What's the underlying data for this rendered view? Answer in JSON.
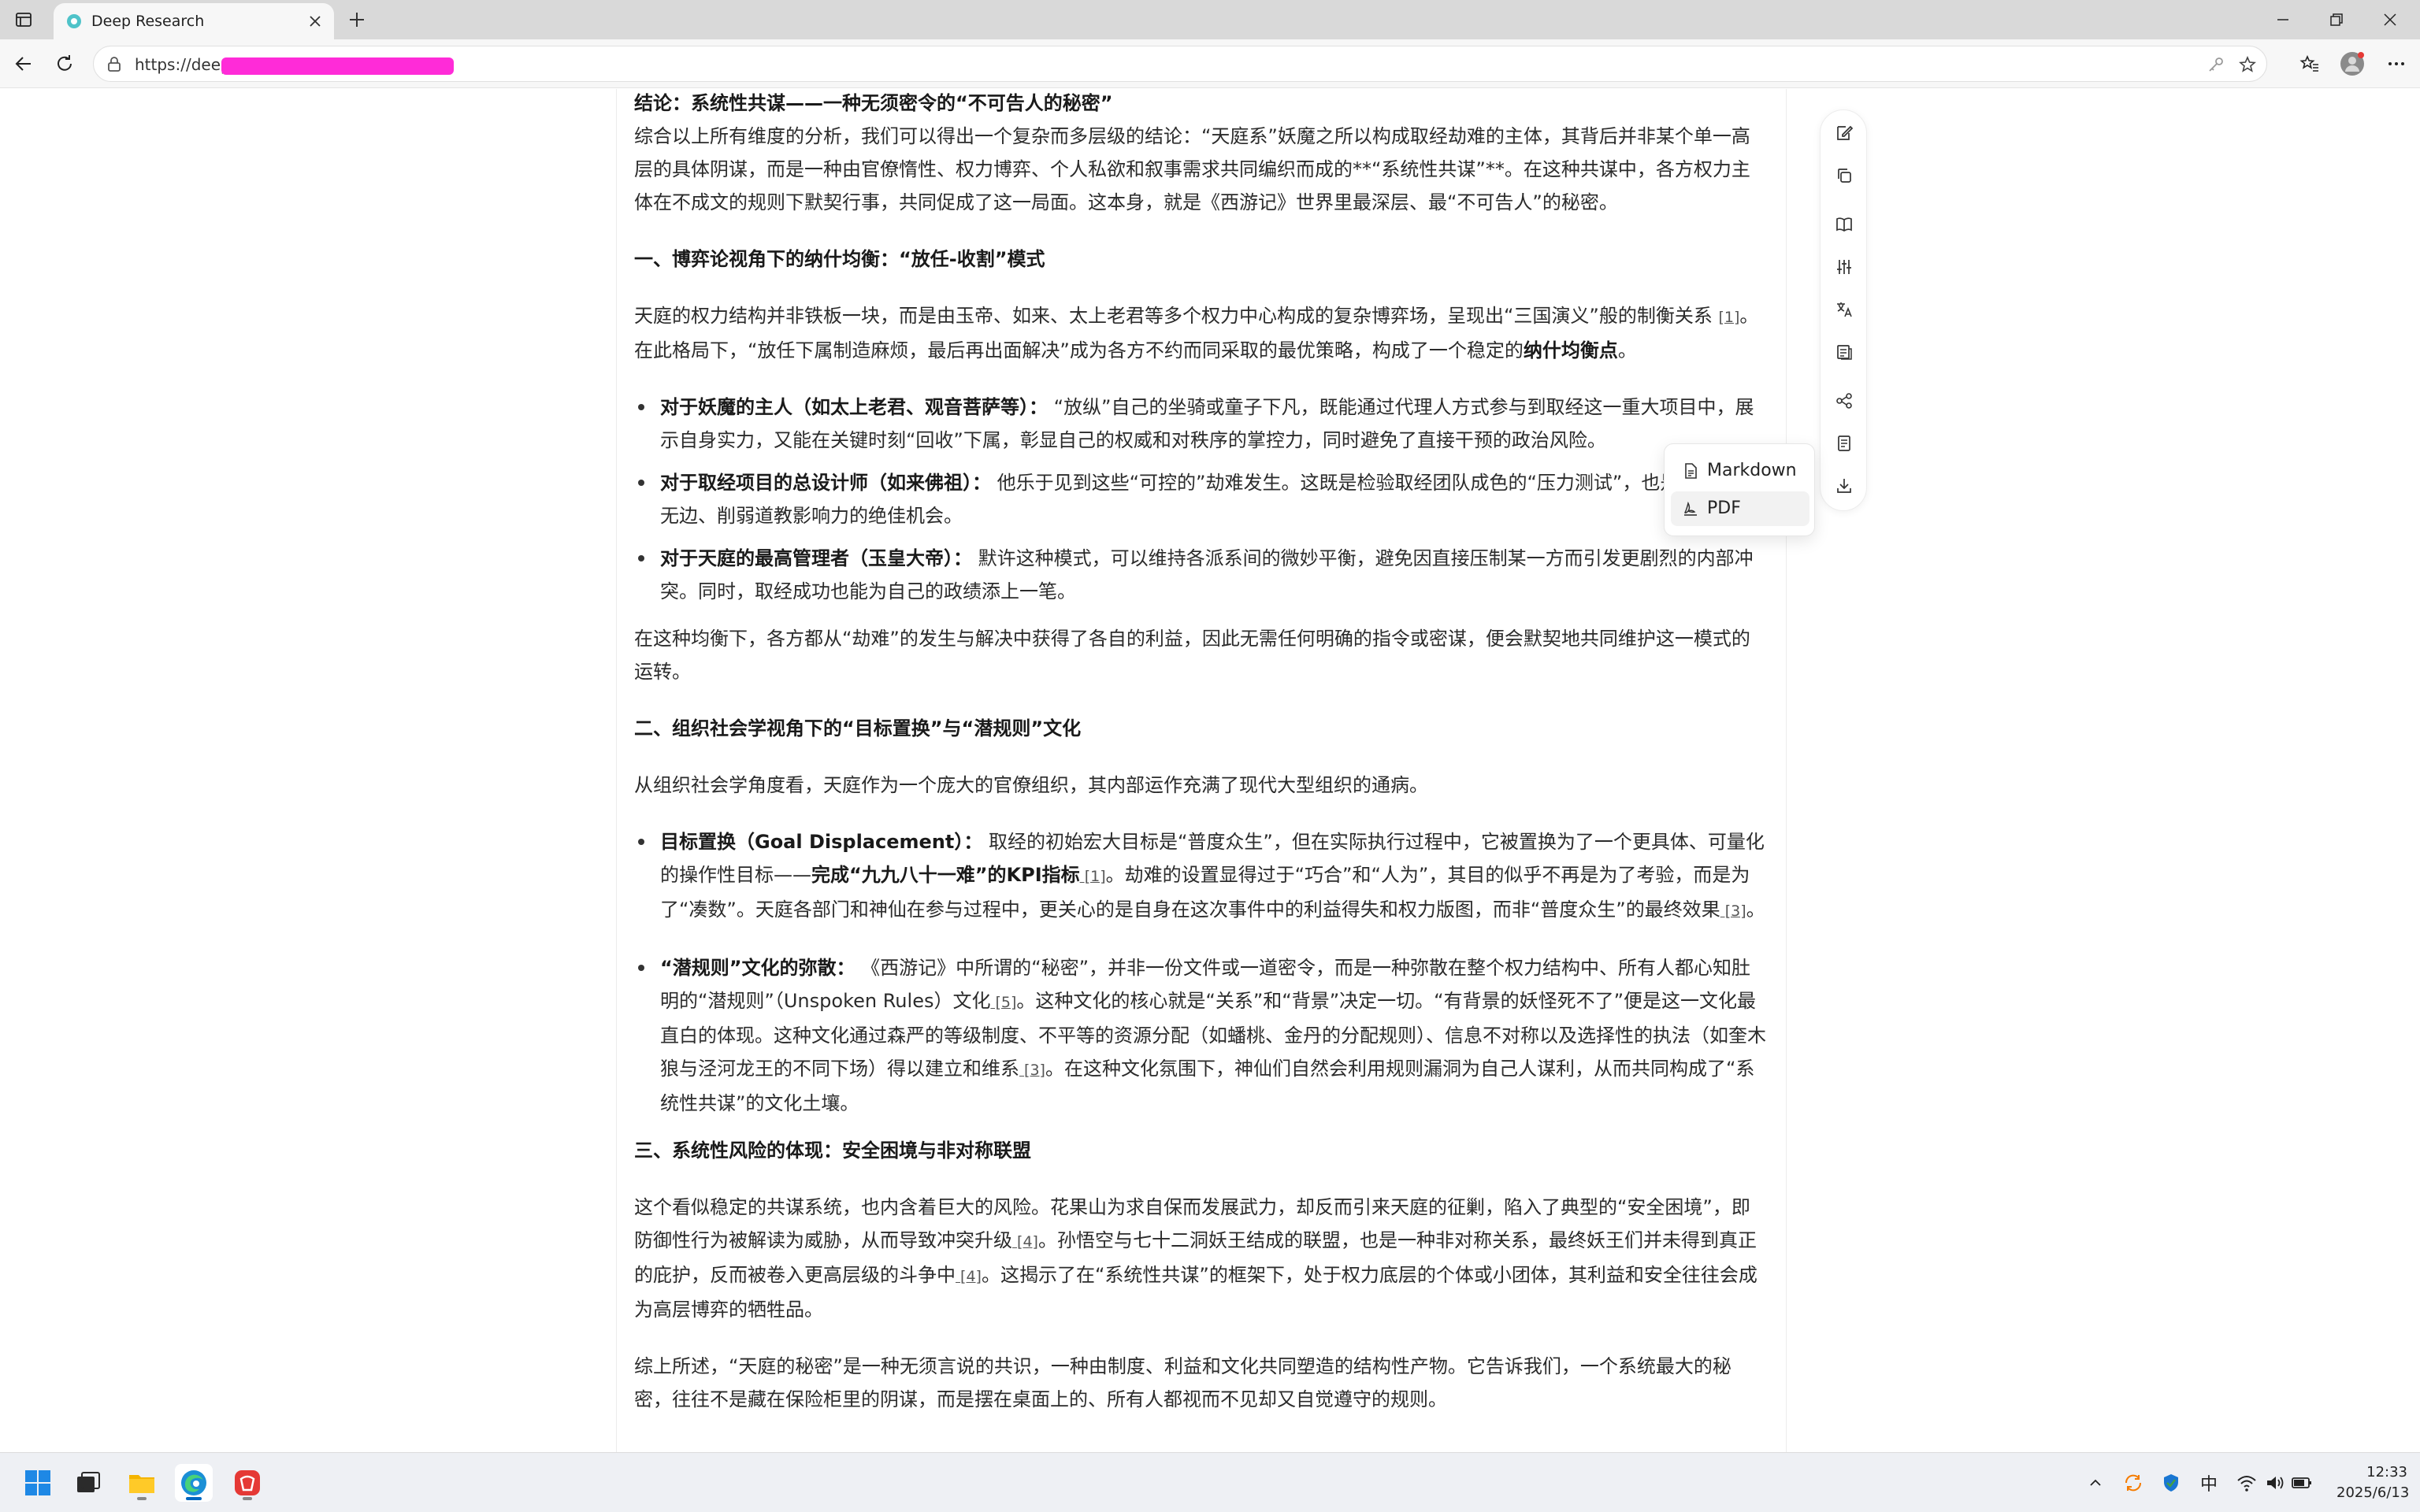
{
  "browser": {
    "tab_title": "Deep Research",
    "url": "https://deep",
    "icons": [
      "sidebar-toggle-icon",
      "favicon",
      "close-icon",
      "plus-icon",
      "minimize-icon",
      "restore-icon",
      "close-window-icon",
      "back-arrow-icon",
      "refresh-icon",
      "lock-icon",
      "key-icon",
      "star-icon",
      "favorites-icon",
      "profile-avatar",
      "more-icon"
    ]
  },
  "article": {
    "conclusion_heading": "结论：系统性共谋——一种无须密令的“不可告人的秘密”",
    "intro": "综合以上所有维度的分析，我们可以得出一个复杂而多层级的结论：“天庭系”妖魔之所以构成取经劫难的主体，其背后并非某个单一高层的具体阴谋，而是一种由官僚惰性、权力博弈、个人私欲和叙事需求共同编织而成的**“系统性共谋”**。在这种共谋中，各方权力主体在不成文的规则下默契行事，共同促成了这一局面。这本身，就是《西游记》世界里最深层、最“不可告人”的秘密。",
    "s1": {
      "heading": "一、博弈论视角下的纳什均衡：“放任-收割”模式",
      "p1_text": "天庭的权力结构并非铁板一块，而是由玉帝、如来、太上老君等多个权力中心构成的复杂博弈场，呈现出“三国演义”般的制衡关系 ",
      "p1_cite": "[1]",
      "p1_text2": "。在此格局下，“放任下属制造麻烦，最后再出面解决”成为各方不约而同采取的最优策略，构成了一个稳定的",
      "p1_bold": "纳什均衡点",
      "p1_end": "。",
      "items": [
        {
          "bold": "对于妖魔的主人（如太上老君、观音菩萨等）：",
          "text": " “放纵”自己的坐骑或童子下凡，既能通过代理人方式参与到取经这一重大项目中，展示自身实力，又能在关键时刻“回收”下属，彰显自己的权威和对秩序的掌控力，同时避免了直接干预的政治风险。"
        },
        {
          "bold": "对于取经项目的总设计师（如来佛祖）：",
          "text": " 他乐于见到这些“可控的”劫难发生。这既是检验取经团队成色的“压力测试”，也是展示佛法无边、削弱道教影响力的绝佳机会。"
        },
        {
          "bold": "对于天庭的最高管理者（玉皇大帝）：",
          "text": " 默许这种模式，可以维持各派系间的微妙平衡，避免因直接压制某一方而引发更剧烈的内部冲突。同时，取经成功也能为自己的政绩添上一笔。"
        }
      ],
      "p2": "在这种均衡下，各方都从“劫难”的发生与解决中获得了各自的利益，因此无需任何明确的指令或密谋，便会默契地共同维护这一模式的运转。"
    },
    "s2": {
      "heading": "二、组织社会学视角下的“目标置换”与“潜规则”文化",
      "p1": "从组织社会学角度看，天庭作为一个庞大的官僚组织，其内部运作充满了现代大型组织的通病。",
      "item1_bold": "目标置换（Goal Displacement）：",
      "item1_text": " 取经的初始宏大目标是“普度众生”，但在实际执行过程中，它被置换为了一个更具体、可量化的操作性目标——",
      "item1_bold2": "完成“九九八十一难”的KPI指标",
      "item1_cite1": " [1]",
      "item1_text2": "。劫难的设置显得过于“巧合”和“人为”，其目的似乎不再是为了考验，而是为了“凑数”。天庭各部门和神仙在参与过程中，更关心的是自身在这次事件中的利益得失和权力版图，而非“普度众生”的最终效果",
      "item1_cite2": " [3]",
      "item1_end": "。",
      "item2_bold": "“潜规则”文化的弥散：",
      "item2_text": " 《西游记》中所谓的“秘密”，并非一份文件或一道密令，而是一种弥散在整个权力结构中、所有人都心知肚明的“潜规则”（Unspoken Rules）文化",
      "item2_cite1": " [5]",
      "item2_text2": "。这种文化的核心就是“关系”和“背景”决定一切。“有背景的妖怪死不了”便是这一文化最直白的体现。这种文化通过森严的等级制度、不平等的资源分配（如蟠桃、金丹的分配规则）、信息不对称以及选择性的执法（如奎木狼与泾河龙王的不同下场）得以建立和维系",
      "item2_cite2": " [3]",
      "item2_end": "。在这种文化氛围下，神仙们自然会利用规则漏洞为自己人谋利，从而共同构成了“系统性共谋”的文化土壤。"
    },
    "s3": {
      "heading": "三、系统性风险的体现：安全困境与非对称联盟",
      "p1_text": "这个看似稳定的共谋系统，也内含着巨大的风险。花果山为求自保而发展武力，却反而引来天庭的征剿，陷入了典型的“安全困境”，即防御性行为被解读为威胁，从而导致冲突升级",
      "p1_cite1": " [4]",
      "p1_text2": "。孙悟空与七十二洞妖王结成的联盟，也是一种非对称关系，最终妖王们并未得到真正的庇护，反而被卷入更高层级的斗争中",
      "p1_cite2": " [4]",
      "p1_end": "。这揭示了在“系统性共谋”的框架下，处于权力底层的个体或小团体，其利益和安全往往会成为高层博弈的牺牲品。",
      "p2": "综上所述，“天庭的秘密”是一种无须言说的共识，一种由制度、利益和文化共同塑造的结构性产物。它告诉我们，一个系统最大的秘密，往往不是藏在保险柜里的阴谋，而是摆在桌面上的、所有人都视而不见却又自觉遵守的规则。"
    }
  },
  "side_toolbar": {
    "icons": [
      "edit-icon",
      "copy-icon",
      "book-icon",
      "sliders-icon",
      "translate-icon",
      "summary-icon",
      "mindmap-icon",
      "notes-icon",
      "download-icon"
    ]
  },
  "export_menu": {
    "items": [
      {
        "label": "Markdown",
        "icon": "markdown-file-icon"
      },
      {
        "label": "PDF",
        "icon": "pdf-file-icon"
      }
    ]
  },
  "taskbar": {
    "apps": [
      "start-icon",
      "task-view-icon",
      "file-explorer-icon",
      "edge-browser-icon",
      "app-icon"
    ],
    "ime": "中",
    "time": "12:33",
    "date": "2025/6/13"
  }
}
